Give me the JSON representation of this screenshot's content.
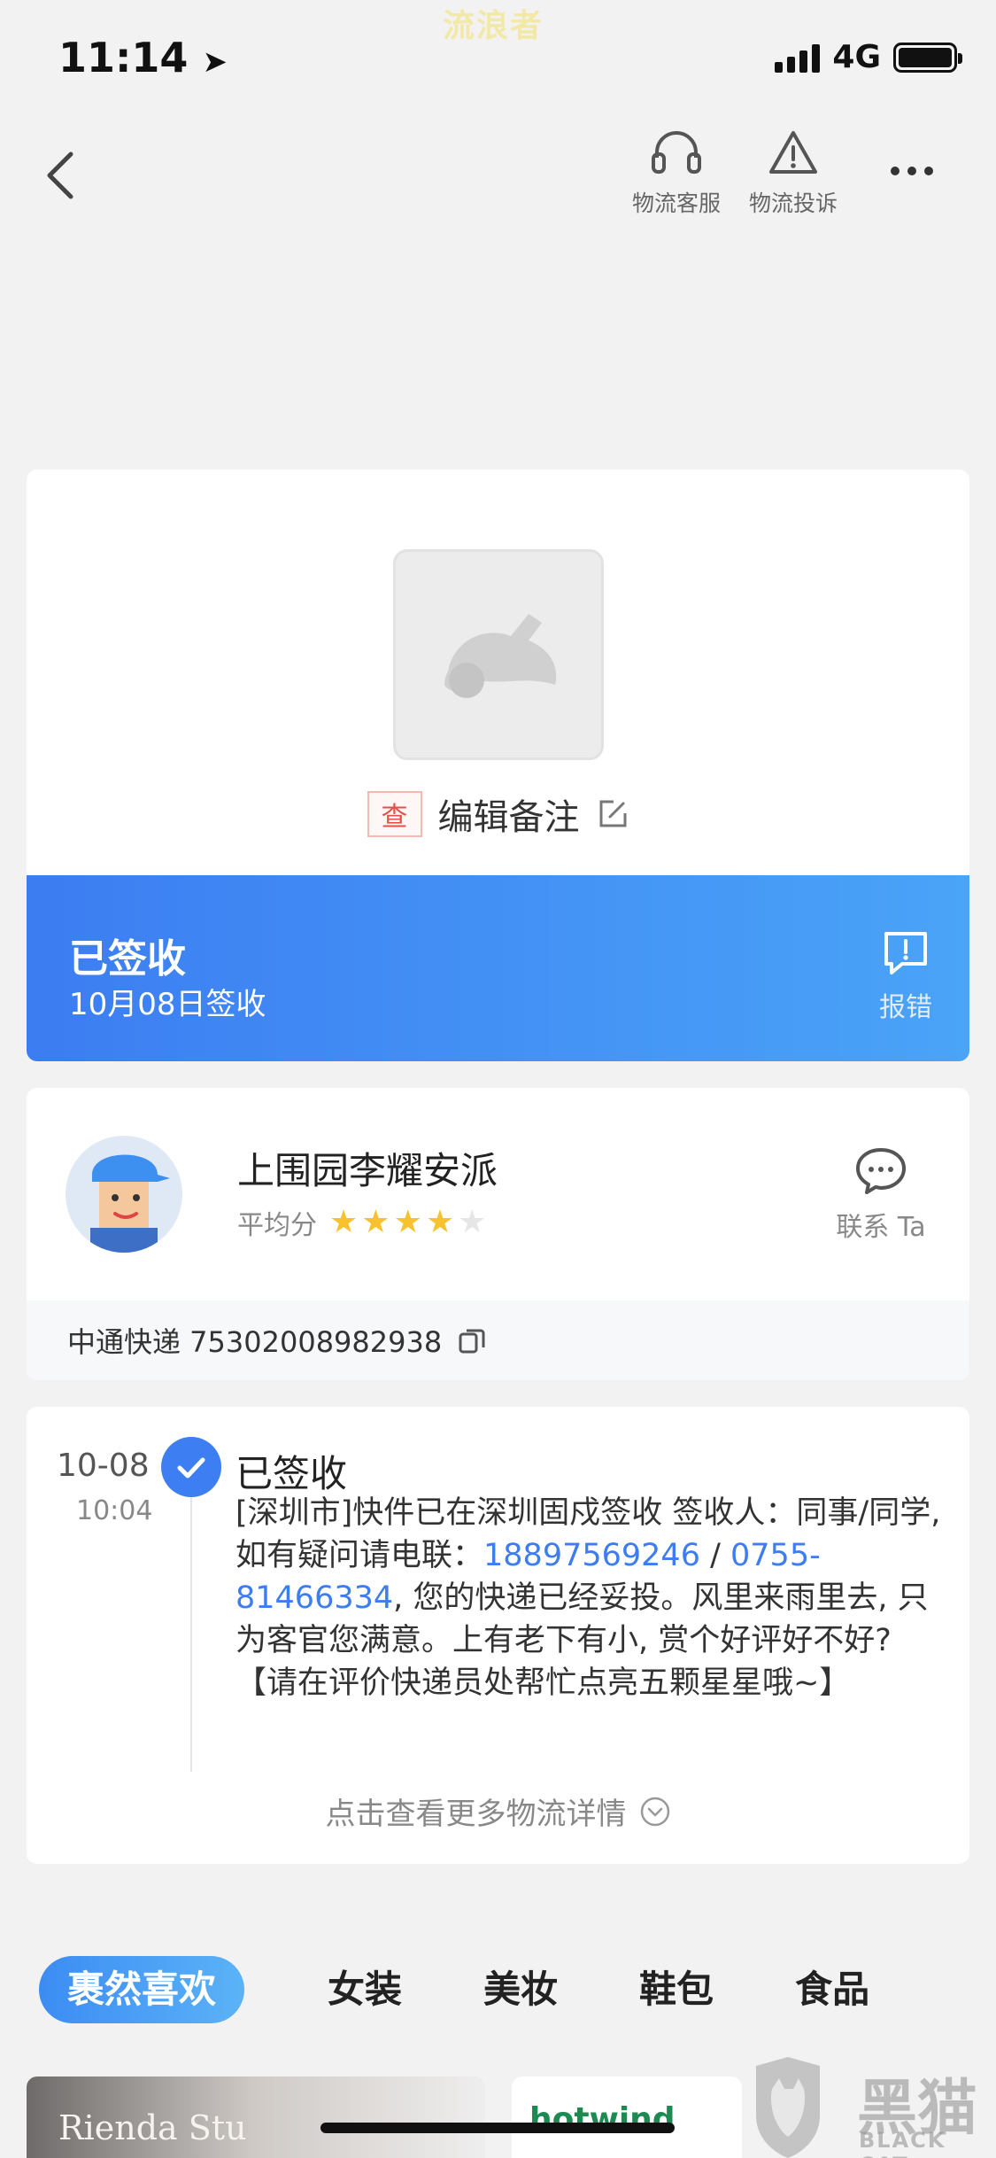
{
  "status_bar": {
    "time": "11:14",
    "watermark": "流浪者",
    "network": "4G"
  },
  "nav": {
    "customer_service": "物流客服",
    "complaint": "物流投诉"
  },
  "package": {
    "check_tag": "查",
    "note_label": "编辑备注"
  },
  "delivery_status": {
    "title": "已签收",
    "date": "10月08日签收",
    "report_label": "报错"
  },
  "courier": {
    "name": "上围园李耀安派",
    "rating_label": "平均分",
    "rating": 4,
    "max_rating": 5,
    "contact_label": "联系 Ta",
    "tracking": "中通快递 75302008982938"
  },
  "timeline": {
    "date": "10-08",
    "time": "10:04",
    "title": "已签收",
    "text_1": "[深圳市]快件已在深圳固戍签收 签收人：同事/同学,如有疑问请电联：",
    "phone_1": "18897569246",
    "sep": " / ",
    "phone_2": "0755-81466334",
    "text_2": ", 您的快递已经妥投。风里来雨里去, 只为客官您满意。上有老下有小, 赏个好评好不好? 【请在评价快递员处帮忙点亮五颗星星哦~】",
    "more_link": "点击查看更多物流详情"
  },
  "categories": [
    "裹然喜欢",
    "女装",
    "美妆",
    "鞋包",
    "食品"
  ],
  "products": {
    "left_brand": "Rienda Stu",
    "right_brand": "hotwind"
  },
  "watermark": {
    "main": "黑猫",
    "sub": "BLACK CAT"
  },
  "colors": {
    "accent_blue": "#3c7df2",
    "star_yellow": "#f7c22d",
    "star_gray": "#e6e6e6"
  }
}
